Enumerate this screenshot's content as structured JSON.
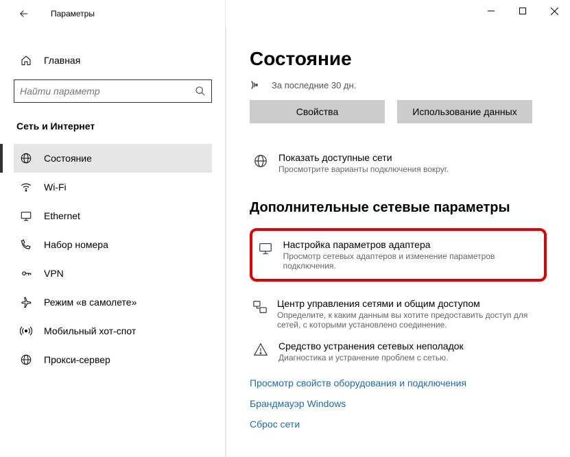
{
  "titlebar": {
    "title": "Параметры"
  },
  "sidebar": {
    "home": "Главная",
    "search_placeholder": "Найти параметр",
    "category": "Сеть и Интернет",
    "items": [
      {
        "label": "Состояние",
        "icon": "globe",
        "active": true
      },
      {
        "label": "Wi-Fi",
        "icon": "wifi",
        "active": false
      },
      {
        "label": "Ethernet",
        "icon": "ethernet",
        "active": false
      },
      {
        "label": "Набор номера",
        "icon": "dialup",
        "active": false
      },
      {
        "label": "VPN",
        "icon": "vpn",
        "active": false
      },
      {
        "label": "Режим «в самолете»",
        "icon": "airplane",
        "active": false
      },
      {
        "label": "Мобильный хот-спот",
        "icon": "hotspot",
        "active": false
      },
      {
        "label": "Прокси-сервер",
        "icon": "proxy",
        "active": false
      }
    ]
  },
  "main": {
    "title": "Состояние",
    "period": "За последние 30 дн.",
    "btn_props": "Свойства",
    "btn_usage": "Использование данных",
    "avail_title": "Показать доступные сети",
    "avail_desc": "Просмотрите варианты подключения вокруг.",
    "adv_section": "Дополнительные сетевые параметры",
    "adapter_title": "Настройка параметров адаптера",
    "adapter_desc": "Просмотр сетевых адаптеров и изменение параметров подключения.",
    "sharing_title": "Центр управления сетями и общим доступом",
    "sharing_desc": "Определите, к каким данным вы хотите предоставить доступ для сетей, с которыми установлено соединение.",
    "trouble_title": "Средство устранения сетевых неполадок",
    "trouble_desc": "Диагностика и устранение проблем с сетью.",
    "link_hw": "Просмотр свойств оборудования и подключения",
    "link_fw": "Брандмауэр Windows",
    "link_reset": "Сброс сети"
  }
}
